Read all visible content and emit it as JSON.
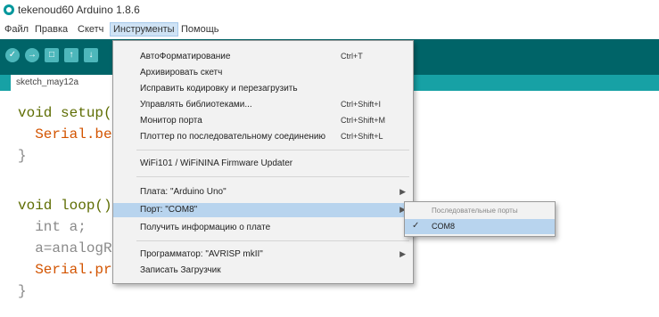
{
  "window": {
    "title": "tekenoud60 Arduino 1.8.6"
  },
  "menubar": [
    "Файл",
    "Правка",
    "Скетч",
    "Инструменты",
    "Помощь"
  ],
  "toolbar": {
    "verify": "✓",
    "upload": "→",
    "new": "□",
    "open": "↑",
    "save": "↓"
  },
  "tab": {
    "label": "sketch_may12a"
  },
  "code": [
    "void setup(){",
    "  Serial.begin(9600);",
    "}",
    "void loop(){",
    "  int a;",
    "  a=analogRead(A0);",
    "  Serial.println(a);delay(300);",
    "}"
  ],
  "dropdown": {
    "items": [
      {
        "label": "АвтоФорматирование",
        "shortcut": "Ctrl+T"
      },
      {
        "label": "Архивировать скетч",
        "shortcut": ""
      },
      {
        "label": "Исправить кодировку и перезагрузить",
        "shortcut": ""
      },
      {
        "label": "Управлять библиотеками...",
        "shortcut": "Ctrl+Shift+I"
      },
      {
        "label": "Монитор порта",
        "shortcut": "Ctrl+Shift+M"
      },
      {
        "label": "Плоттер по последовательному соединению",
        "shortcut": "Ctrl+Shift+L"
      },
      {
        "label": "WiFi101 / WiFiNINA Firmware Updater",
        "shortcut": ""
      },
      {
        "label": "Плата: \"Arduino Uno\"",
        "shortcut": ""
      },
      {
        "label": "Порт: \"COM8\"",
        "shortcut": ""
      },
      {
        "label": "Получить информацию о плате",
        "shortcut": ""
      },
      {
        "label": "Программатор: \"AVRISP mkII\"",
        "shortcut": ""
      },
      {
        "label": "Записать Загрузчик",
        "shortcut": ""
      }
    ]
  },
  "submenu": {
    "header": "Последовательные порты",
    "item": "COM8",
    "check": "✓"
  }
}
